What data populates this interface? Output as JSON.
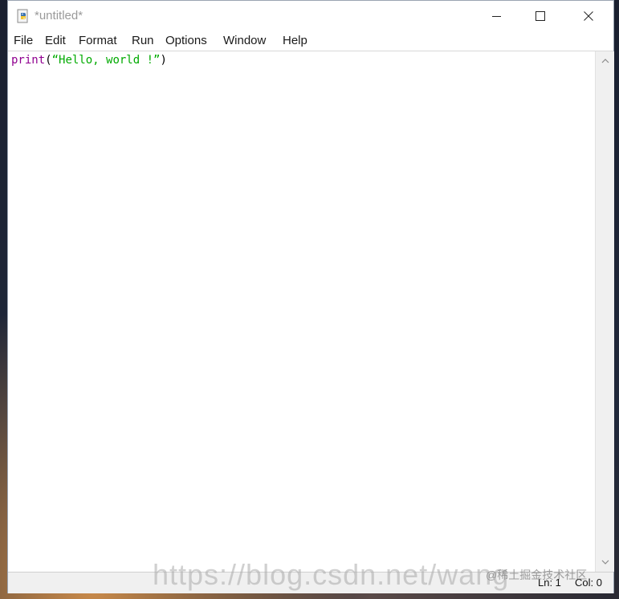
{
  "window": {
    "title": "*untitled*"
  },
  "menu": [
    {
      "label": "File"
    },
    {
      "label": "Edit"
    },
    {
      "label": "Format"
    },
    {
      "label": "Run"
    },
    {
      "label": "Options"
    },
    {
      "label": "Window"
    },
    {
      "label": "Help"
    }
  ],
  "editor": {
    "code": {
      "keyword": "print",
      "open_paren": "(",
      "string": "“Hello, world !”",
      "close_paren": ")"
    }
  },
  "status": {
    "line": "Ln: 1",
    "col": "Col: 0"
  },
  "watermark": {
    "url": "https://blog.csdn.net/wang",
    "badge": "@稀土掘金技术社区"
  },
  "colors": {
    "keyword": "#900090",
    "string": "#00aa00"
  },
  "icons": {
    "app": "python-idle-icon",
    "minimize": "minimize-icon",
    "maximize": "maximize-icon",
    "close": "close-icon"
  }
}
